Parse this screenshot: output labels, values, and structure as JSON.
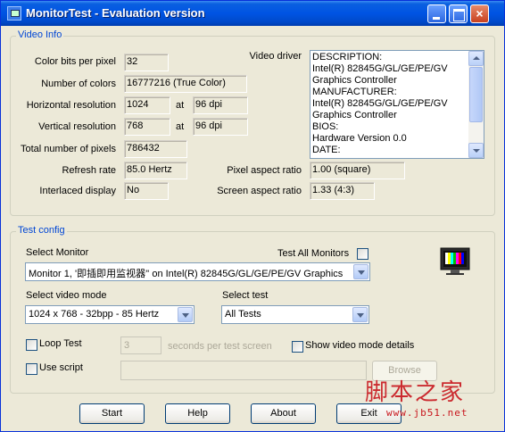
{
  "window": {
    "title": "MonitorTest - Evaluation version"
  },
  "video_info": {
    "group_title": "Video Info",
    "color_bits": {
      "label": "Color bits per pixel",
      "value": "32"
    },
    "num_colors": {
      "label": "Number of colors",
      "value": "16777216 (True Color)"
    },
    "horiz_res": {
      "label": "Horizontal resolution",
      "value": "1024",
      "at": "at",
      "dpi": "96 dpi"
    },
    "vert_res": {
      "label": "Vertical resolution",
      "value": "768",
      "at": "at",
      "dpi": "96 dpi"
    },
    "total_pixels": {
      "label": "Total number of pixels",
      "value": "786432"
    },
    "refresh": {
      "label": "Refresh rate",
      "value": "85.0 Hertz"
    },
    "interlaced": {
      "label": "Interlaced display",
      "value": "No"
    },
    "video_driver": {
      "label": "Video driver",
      "lines": [
        "DESCRIPTION:",
        "Intel(R) 82845G/GL/GE/PE/GV",
        "Graphics Controller",
        "MANUFACTURER:",
        "Intel(R) 82845G/GL/GE/PE/GV",
        "Graphics Controller",
        "BIOS:",
        "Hardware Version 0.0",
        "DATE:"
      ]
    },
    "pixel_aspect": {
      "label": "Pixel aspect ratio",
      "value": "1.00 (square)"
    },
    "screen_aspect": {
      "label": "Screen aspect ratio",
      "value": "1.33 (4:3)"
    }
  },
  "test_config": {
    "group_title": "Test config",
    "select_monitor_label": "Select Monitor",
    "test_all_label": "Test All Monitors",
    "monitor_value": "Monitor 1, '即插即用监视器'' on Intel(R) 82845G/GL/GE/PE/GV Graphics",
    "video_mode_label": "Select video mode",
    "video_mode_value": "1024 x 768 - 32bpp - 85 Hertz",
    "select_test_label": "Select test",
    "test_value": "All Tests",
    "loop_test_label": "Loop Test",
    "loop_seconds": "3",
    "seconds_label": "seconds per test screen",
    "show_video_mode_label": "Show video mode details",
    "use_script_label": "Use script",
    "browse_label": "Browse"
  },
  "buttons": {
    "start": "Start",
    "help": "Help",
    "about": "About",
    "exit": "Exit"
  },
  "watermark": {
    "text": "脚本之家",
    "url": "www.jb51.net"
  }
}
